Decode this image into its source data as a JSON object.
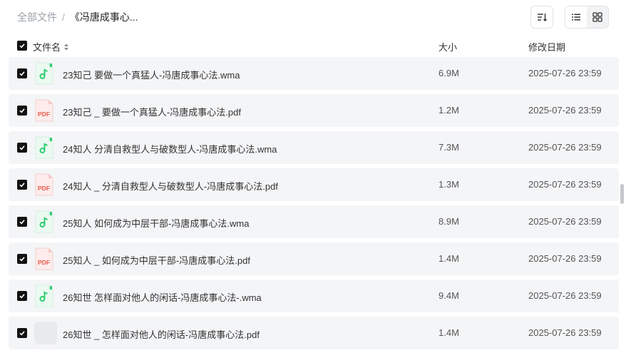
{
  "breadcrumb": {
    "root": "全部文件",
    "separator": "/",
    "current": "《冯唐成事心..."
  },
  "toolbar": {
    "sort_icon": "sort-descending-icon",
    "list_view_icon": "list-view-icon",
    "grid_view_icon": "grid-view-icon",
    "active_view": "list"
  },
  "columns": {
    "name": "文件名",
    "size": "大小",
    "modified": "修改日期"
  },
  "colors": {
    "audio_accent": "#2ecc71",
    "pdf_accent": "#e85a4f",
    "row_bg": "#f4f5f7"
  },
  "files": [
    {
      "type": "audio",
      "icon": "audio-file-icon",
      "name": "23知己 要做一个真猛人-冯唐成事心法.wma",
      "size": "6.9M",
      "modified": "2025-07-26 23:59",
      "checked": true
    },
    {
      "type": "pdf",
      "icon": "pdf-file-icon",
      "icon_label": "PDF",
      "name": "23知己 _ 要做一个真猛人-冯唐成事心法.pdf",
      "size": "1.2M",
      "modified": "2025-07-26 23:59",
      "checked": true
    },
    {
      "type": "audio",
      "icon": "audio-file-icon",
      "name": "24知人 分清自救型人与破数型人-冯唐成事心法.wma",
      "size": "7.3M",
      "modified": "2025-07-26 23:59",
      "checked": true
    },
    {
      "type": "pdf",
      "icon": "pdf-file-icon",
      "icon_label": "PDF",
      "name": "24知人 _ 分清自救型人与破数型人-冯唐成事心法.pdf",
      "size": "1.3M",
      "modified": "2025-07-26 23:59",
      "checked": true
    },
    {
      "type": "audio",
      "icon": "audio-file-icon",
      "name": "25知人 如何成为中层干部-冯唐成事心法.wma",
      "size": "8.9M",
      "modified": "2025-07-26 23:59",
      "checked": true
    },
    {
      "type": "pdf",
      "icon": "pdf-file-icon",
      "icon_label": "PDF",
      "name": "25知人 _ 如何成为中层干部-冯唐成事心法.pdf",
      "size": "1.4M",
      "modified": "2025-07-26 23:59",
      "checked": true
    },
    {
      "type": "audio",
      "icon": "audio-file-icon",
      "name": "26知世 怎样面对他人的闲话-冯唐成事心法-.wma",
      "size": "9.4M",
      "modified": "2025-07-26 23:59",
      "checked": true
    },
    {
      "type": "blank",
      "icon": "file-placeholder-icon",
      "name": "26知世 _ 怎样面对他人的闲话-冯唐成事心法.pdf",
      "size": "1.4M",
      "modified": "2025-07-26 23:59",
      "checked": true
    }
  ]
}
